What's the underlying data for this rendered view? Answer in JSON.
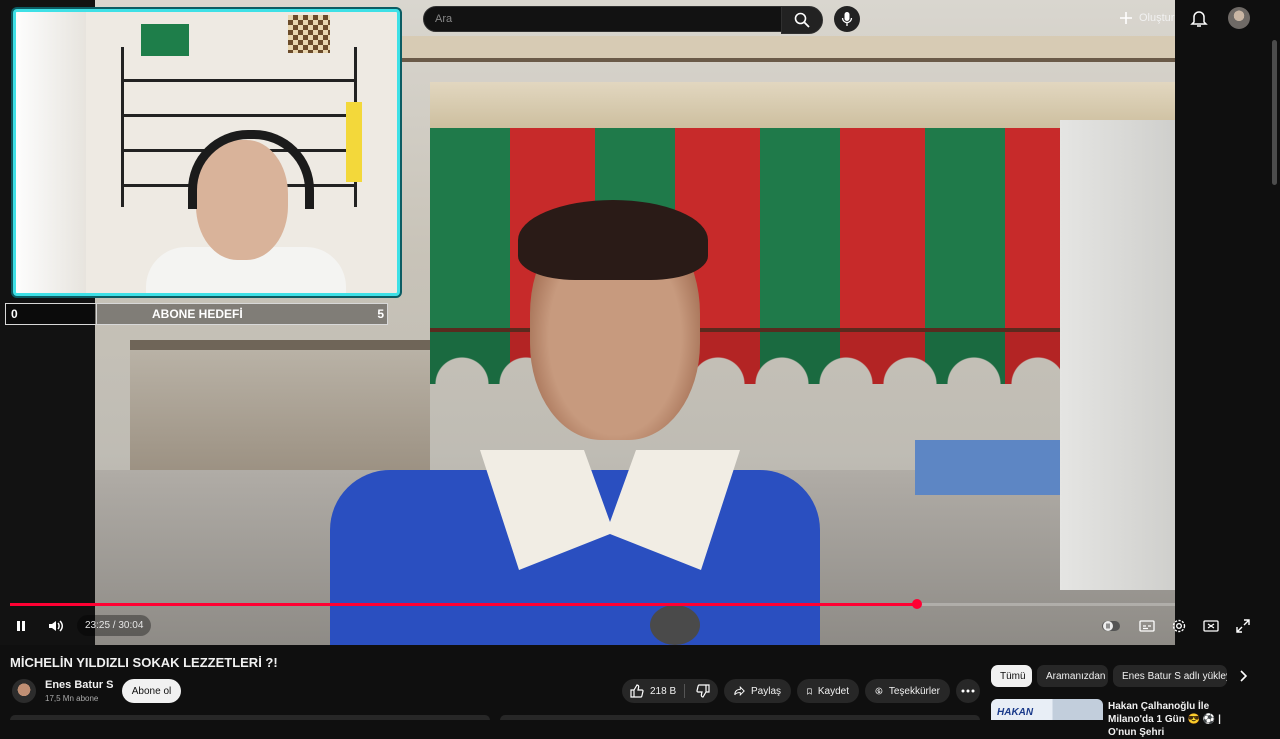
{
  "masthead": {
    "search_placeholder": "Ara",
    "create_label": "Oluştur"
  },
  "overlay": {
    "goal_start": "0",
    "goal_label": "ABONE HEDEFİ",
    "goal_end": "5"
  },
  "player": {
    "time_display": "23:25 / 30:04",
    "progress_fraction": 0.7789
  },
  "video": {
    "title": "MİCHELİN YILDIZLI SOKAK LEZZETLERİ ?!",
    "channel_name": "Enes Batur S",
    "subscribers": "17,5 Mn abone",
    "subscribe_label": "Abone ol",
    "like_count": "218 B",
    "share_label": "Paylaş",
    "save_label": "Kaydet",
    "thanks_label": "Teşekkürler"
  },
  "chips": {
    "all": "Tümü",
    "search": "Aramanızdan",
    "channel": "Enes Batur S adlı yükleyi"
  },
  "recommendation": {
    "thumb_text": "HAKAN",
    "title": "Hakan Çalhanoğlu İle Milano'da 1 Gün 😎 ⚽ | O'nun Şehri"
  },
  "colors": {
    "accent": "#ff0033",
    "webcam_border": "#3ee0e6",
    "background": "#0f0f0f"
  }
}
